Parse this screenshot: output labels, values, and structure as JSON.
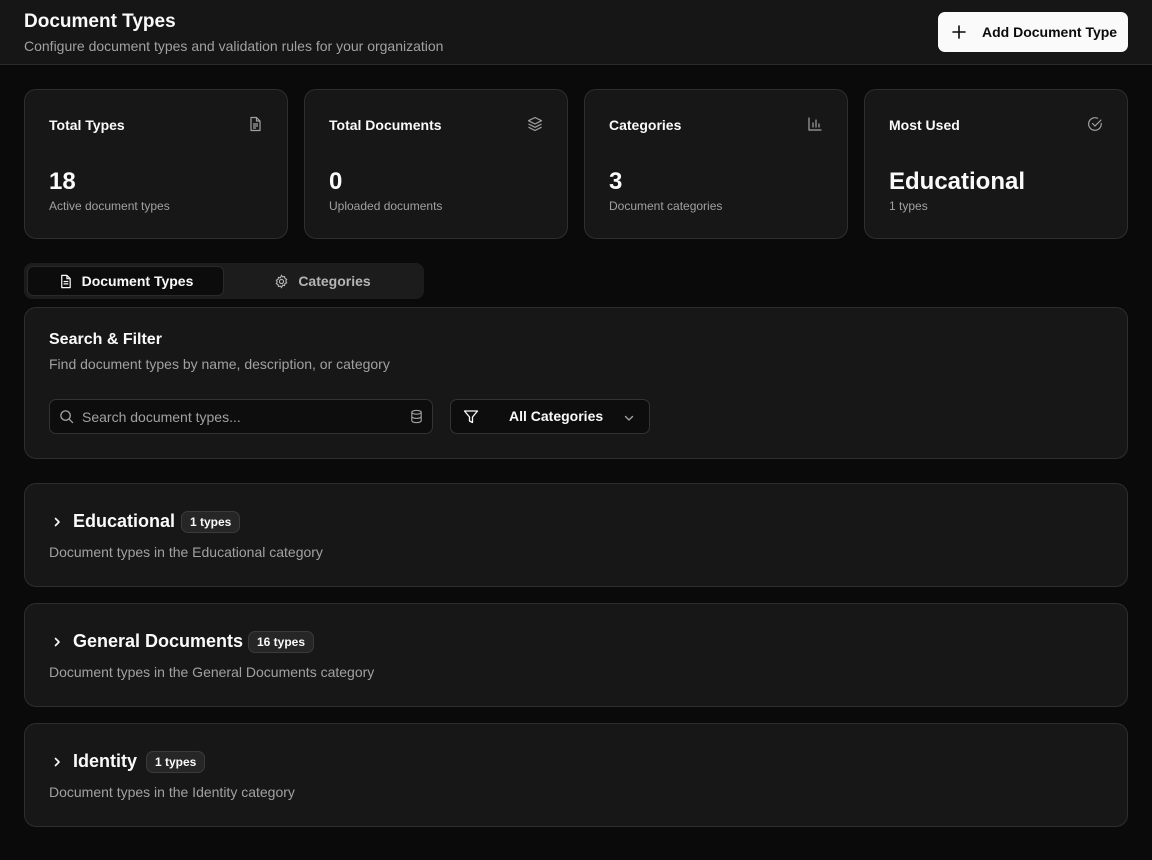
{
  "header": {
    "title": "Document Types",
    "subtitle": "Configure document types and validation rules for your organization",
    "add_label": "Add Document Type"
  },
  "stats": [
    {
      "title": "Total Types",
      "value": "18",
      "sub": "Active document types",
      "icon": "file-text-icon"
    },
    {
      "title": "Total Documents",
      "value": "0",
      "sub": "Uploaded documents",
      "icon": "layers-icon"
    },
    {
      "title": "Categories",
      "value": "3",
      "sub": "Document categories",
      "icon": "bar-chart-icon"
    },
    {
      "title": "Most Used",
      "value": "Educational",
      "sub": "1 types",
      "icon": "check-circle-icon"
    }
  ],
  "tabs": [
    {
      "label": "Document Types",
      "active": true,
      "icon": "file-text-icon"
    },
    {
      "label": "Categories",
      "active": false,
      "icon": "gear-icon"
    }
  ],
  "search_filter": {
    "title": "Search & Filter",
    "description": "Find document types by name, description, or category",
    "search_placeholder": "Search document types...",
    "search_value": "",
    "filter_label": "All Categories"
  },
  "categories": [
    {
      "name": "Educational",
      "badge": "1 types",
      "description": "Document types in the Educational category"
    },
    {
      "name": "General Documents",
      "badge": "16 types",
      "description": "Document types in the General Documents category"
    },
    {
      "name": "Identity",
      "badge": "1 types",
      "description": "Document types in the Identity category"
    }
  ],
  "colors": {
    "background": "#0a0a0a",
    "card": "#171717",
    "border": "#2e2e2e",
    "text": "#fafafa",
    "muted": "#a1a1a1",
    "button_bg": "#fafafa"
  }
}
